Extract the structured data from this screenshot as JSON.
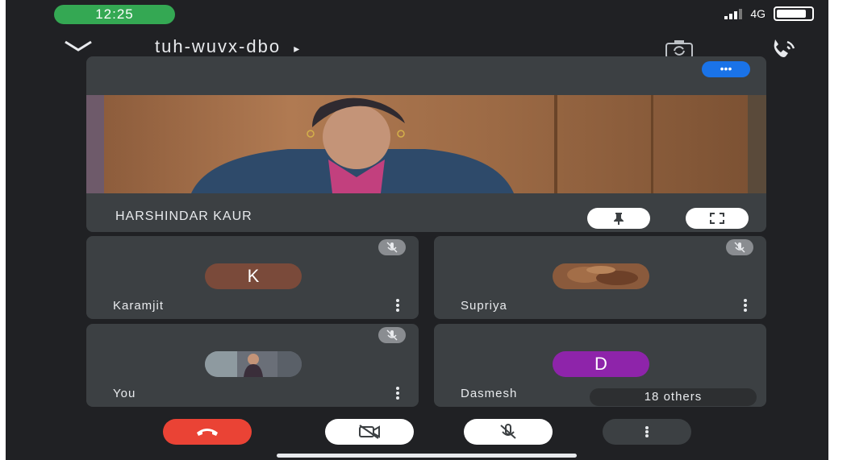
{
  "status_bar": {
    "time": "12:25",
    "network": "4G"
  },
  "header": {
    "meeting_code": "tuh-wuvx-dbo",
    "meeting_code_arrow": "▸",
    "icons": [
      "chevron-down-icon",
      "switch-camera-icon",
      "audio-output-icon"
    ]
  },
  "main_tile": {
    "participant_name": "HARSHINDAR KAUR",
    "more_label": "•••",
    "buttons": [
      "pin-icon",
      "fullscreen-icon"
    ]
  },
  "tiles": [
    {
      "name": "Karamjit",
      "avatar_letter": "K",
      "avatar_color": "#7a4a3a"
    },
    {
      "name": "Supriya",
      "avatar_letter": "",
      "avatar_color": "#8a5a3c"
    },
    {
      "name": "You",
      "avatar_letter": "",
      "avatar_color": "#6a6f78"
    },
    {
      "name": "Dasmesh",
      "avatar_letter": "D",
      "avatar_color": "#8e24aa",
      "others_label": "18 others"
    }
  ],
  "controls": [
    "end-call-icon",
    "camera-off-icon",
    "mic-off-icon",
    "more-options-icon"
  ],
  "colors": {
    "background": "#202124",
    "tile": "#3c4043",
    "end_call": "#ea4335",
    "accent_blue": "#1a73e8",
    "status_green": "#34a853"
  }
}
